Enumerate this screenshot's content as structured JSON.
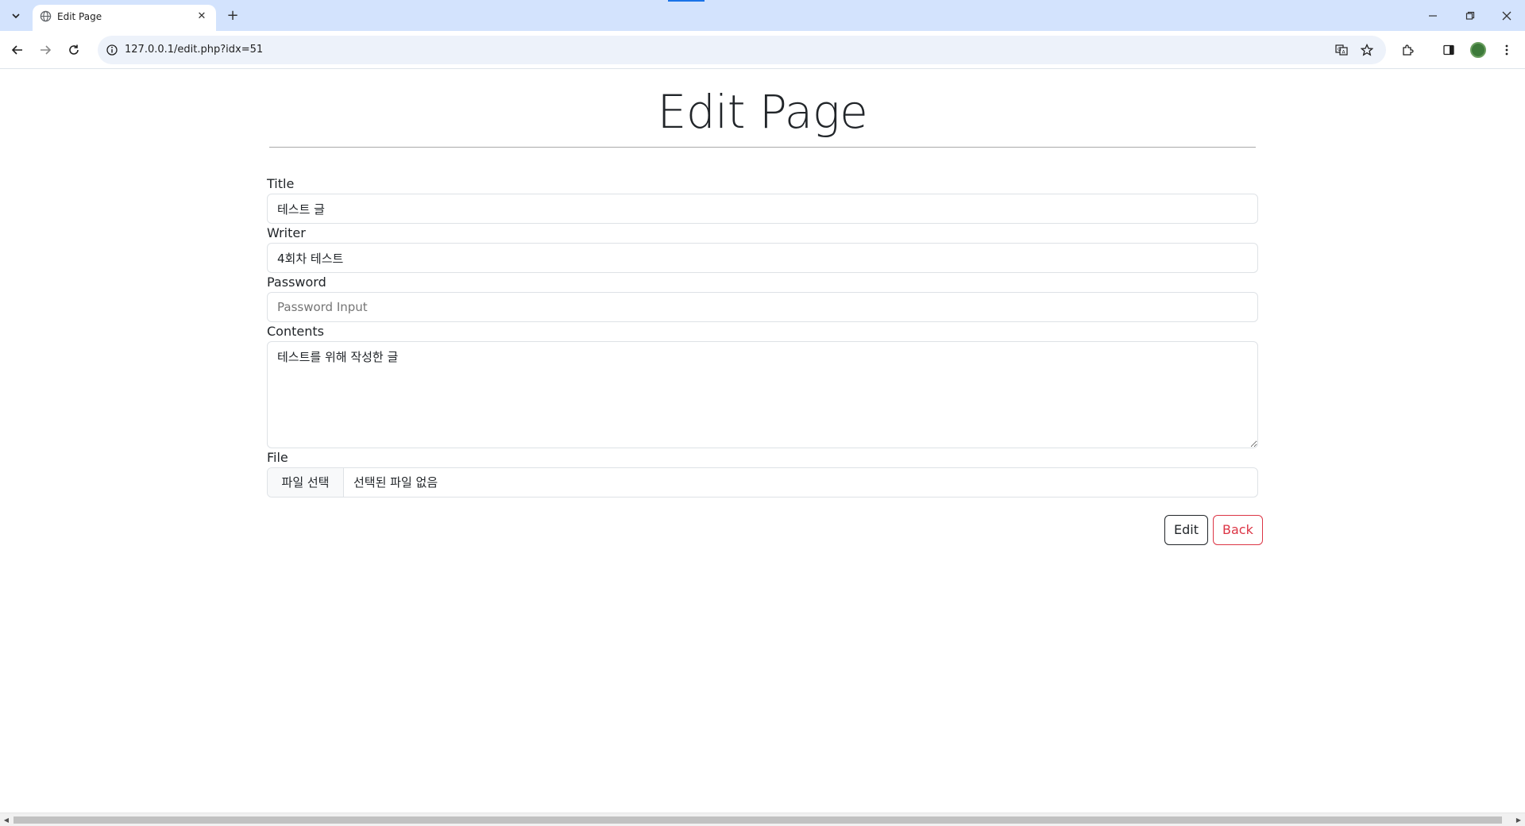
{
  "browser": {
    "tab": {
      "title": "Edit Page"
    },
    "address_url": "127.0.0.1/edit.php?idx=51"
  },
  "page": {
    "heading": "Edit Page",
    "form": {
      "title": {
        "label": "Title",
        "value": "테스트 글"
      },
      "writer": {
        "label": "Writer",
        "value": "4회차 테스트"
      },
      "password": {
        "label": "Password",
        "value": "",
        "placeholder": "Password Input"
      },
      "contents": {
        "label": "Contents",
        "value": "테스트를 위해 작성한 글"
      },
      "file": {
        "label": "File",
        "button_label": "파일 선택",
        "status": "선택된 파일 없음"
      }
    },
    "buttons": {
      "edit": "Edit",
      "back": "Back"
    }
  },
  "colors": {
    "chrome_tabbar": "#d3e3fd",
    "omnibox": "#edf2fa",
    "back_button": "#dc3545",
    "edit_button": "#212529"
  }
}
